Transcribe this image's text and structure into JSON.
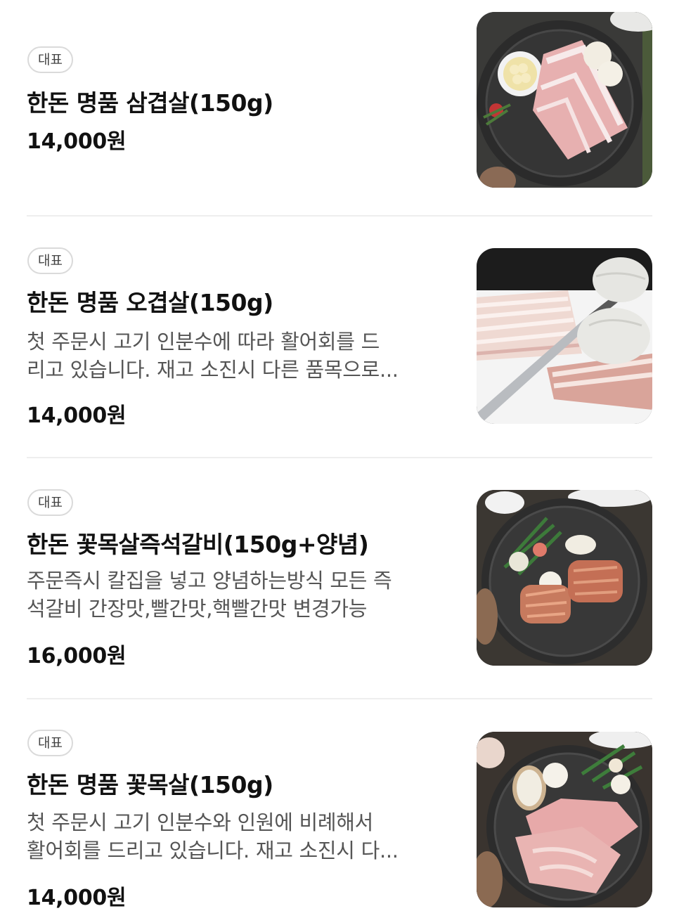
{
  "menu": {
    "items": [
      {
        "badge": "대표",
        "name": "한돈 명품 삼겹살(150g)",
        "description": [],
        "price": "14,000원",
        "image_icon": "pork-belly-plate-photo"
      },
      {
        "badge": "대표",
        "name": "한돈 명품 오겹살(150g)",
        "description": [
          "첫 주문시 고기 인분수에 따라 활어회를 드",
          "리고 있습니다. 재고 소진시 다른 품목으로..."
        ],
        "price": "14,000원",
        "image_icon": "pork-slicing-photo"
      },
      {
        "badge": "대표",
        "name": "한돈 꽃목살즉석갈비(150g+양념)",
        "description": [
          "주문즉시 칼집을 넣고 양념하는방식 모든 즉",
          "석갈비 간장맛,빨간맛,핵빨간맛 변경가능"
        ],
        "price": "16,000원",
        "image_icon": "marinated-galbi-plate-photo"
      },
      {
        "badge": "대표",
        "name": "한돈 명품 꽃목살(150g)",
        "description": [
          "첫 주문시 고기 인분수와 인원에 비례해서",
          "활어회를 드리고 있습니다. 재고 소진시 다..."
        ],
        "price": "14,000원",
        "image_icon": "pork-neck-plate-photo"
      }
    ]
  }
}
